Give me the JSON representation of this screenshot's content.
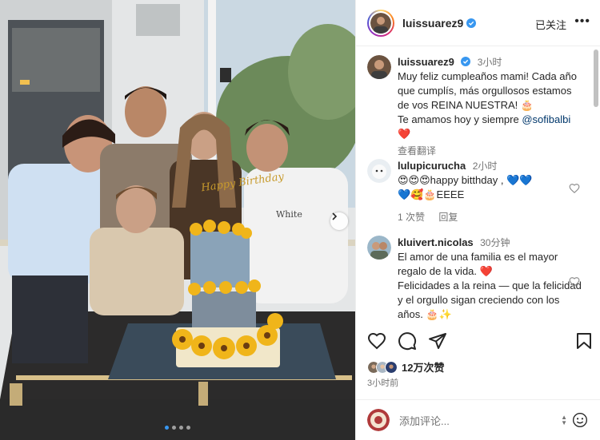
{
  "header": {
    "username": "luissuarez9",
    "follow_status": "已关注",
    "more_label": "•••"
  },
  "caption": {
    "username": "luissuarez9",
    "time": "3小时",
    "text_main": "Muy feliz cumpleaños mami! Cada año que cumplís, más orgullosos estamos de vos REINA NUESTRA! 🎂\nTe amamos hoy y siempre ",
    "mention": "@sofibalbi",
    "text_tail": "\n❤️",
    "translate": "查看翻译"
  },
  "comments": [
    {
      "username": "lulupicurucha",
      "time": "2小时",
      "text": "😍😍😍happy bitthday , 💙💙\n💙🥰🎂EEEE",
      "likes": "1 次赞",
      "reply": "回复"
    },
    {
      "username": "kluivert.nicolas",
      "time": "30分钟",
      "text": "El amor de una familia es el mayor regalo de la vida. ❤️\nFelicidades a la reina — que la felicidad y el orgullo sigan creciendo con los años. 🎂✨"
    }
  ],
  "post": {
    "likes": "12万次赞",
    "time": "3小时前"
  },
  "composer": {
    "placeholder": "添加评论..."
  },
  "photo": {
    "cake_topper": "Happy Birthday",
    "shirt_text": "White"
  },
  "icons": {
    "like": "heart-icon",
    "comment": "comment-icon",
    "share": "send-icon",
    "save": "bookmark-icon",
    "emoji": "emoji-icon",
    "next": "chevron-right-icon"
  },
  "colors": {
    "verified": "#3897f0",
    "mention": "#00376b",
    "heart": "#ed4956"
  }
}
